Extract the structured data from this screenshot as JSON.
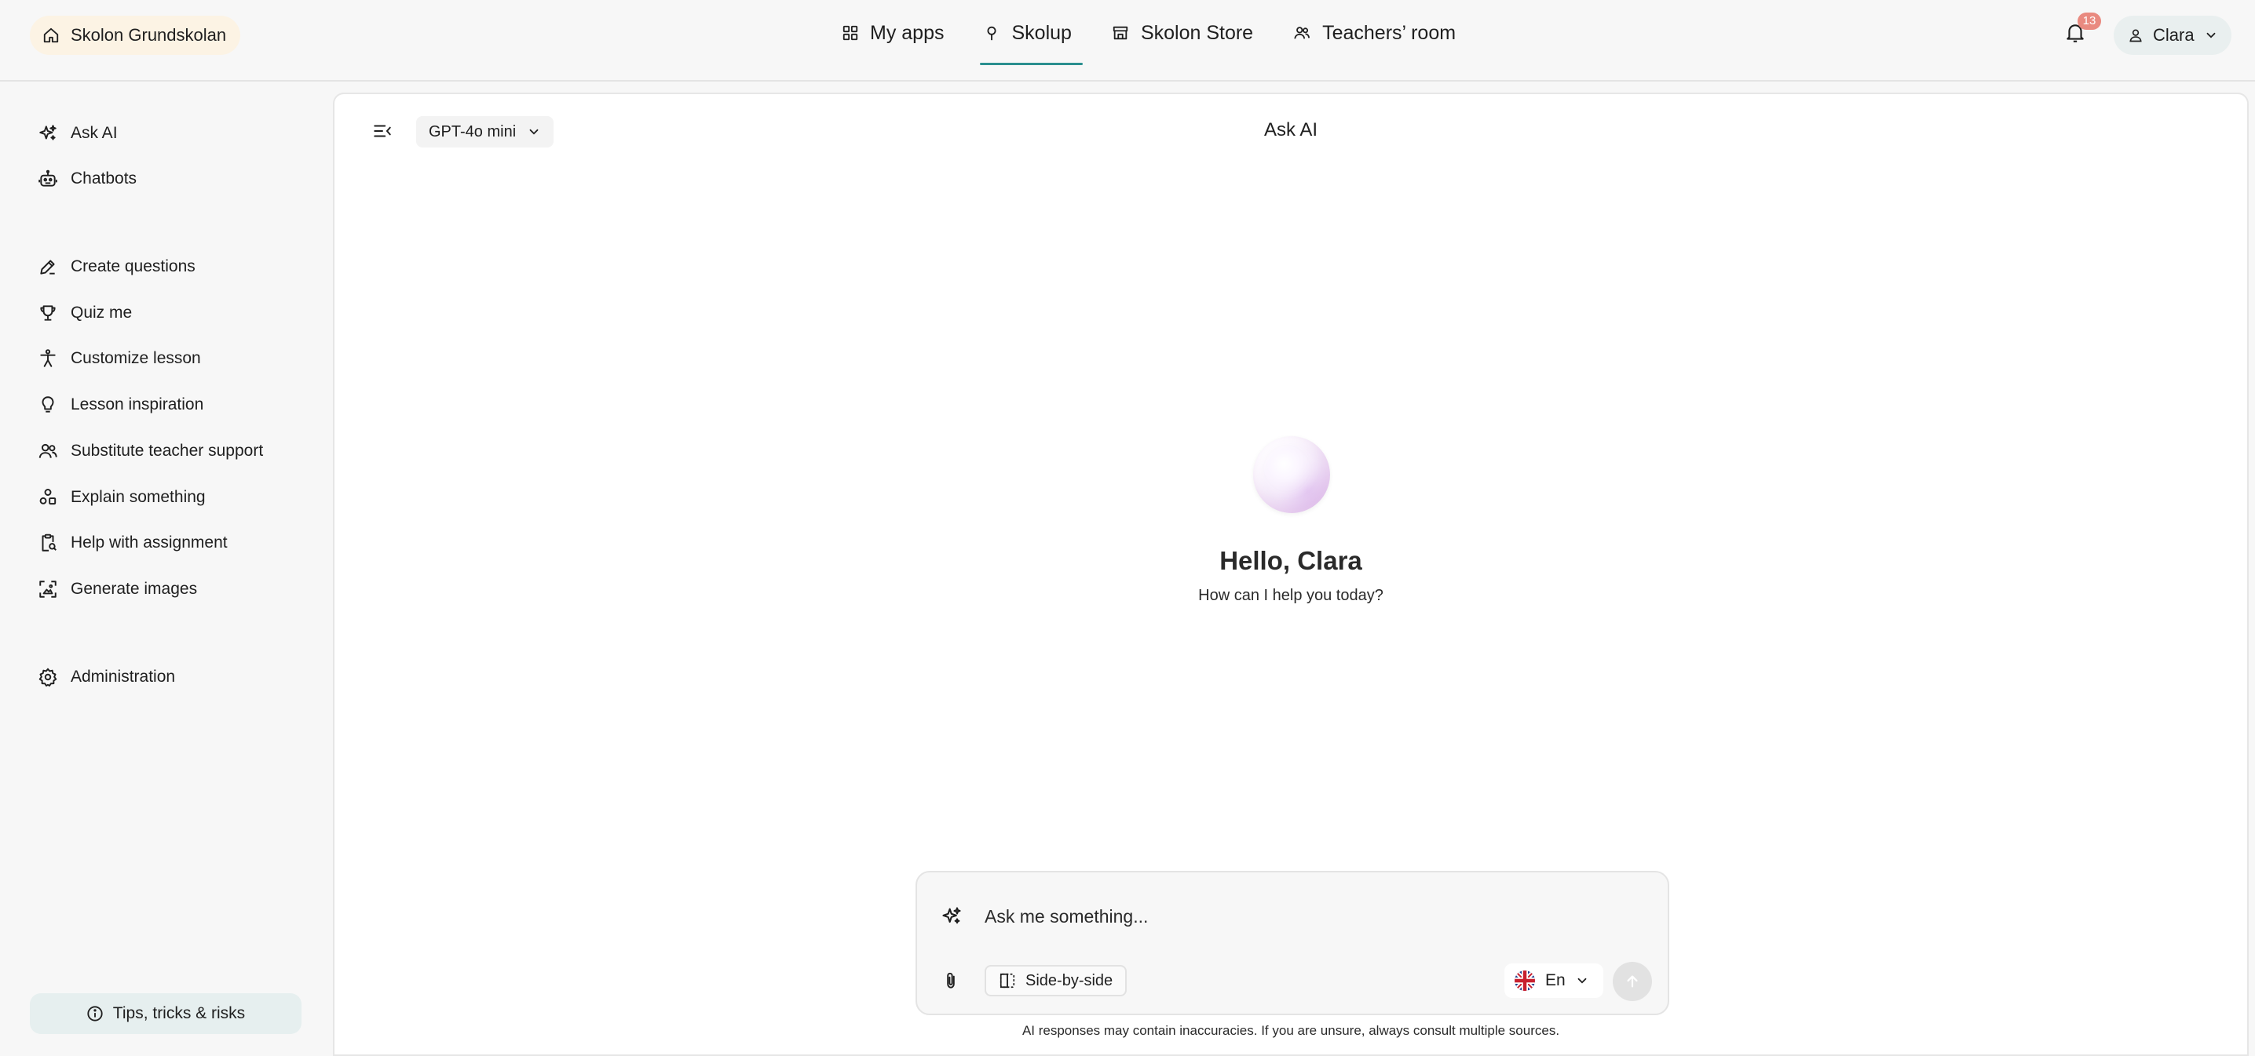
{
  "topbar": {
    "school_name": "Skolon Grundskolan",
    "nav": [
      {
        "label": "My apps",
        "icon": "grid-icon"
      },
      {
        "label": "Skolup",
        "icon": "map-pin-icon",
        "active": true
      },
      {
        "label": "Skolon Store",
        "icon": "store-icon"
      },
      {
        "label": "Teachers’ room",
        "icon": "people-icon"
      }
    ],
    "notification_count": "13",
    "user_name": "Clara"
  },
  "sidebar": {
    "items": [
      {
        "label": "Ask AI",
        "icon": "sparkle-icon"
      },
      {
        "label": "Chatbots",
        "icon": "robot-icon"
      },
      {
        "label": "Create questions",
        "icon": "pen-icon"
      },
      {
        "label": "Quiz me",
        "icon": "trophy-icon"
      },
      {
        "label": "Customize lesson",
        "icon": "accessibility-icon"
      },
      {
        "label": "Lesson inspiration",
        "icon": "lightbulb-icon"
      },
      {
        "label": "Substitute teacher support",
        "icon": "people-icon"
      },
      {
        "label": "Explain something",
        "icon": "shapes-icon"
      },
      {
        "label": "Help with assignment",
        "icon": "clipboard-search-icon"
      },
      {
        "label": "Generate images",
        "icon": "image-frame-icon"
      },
      {
        "label": "Administration",
        "icon": "gear-icon"
      }
    ],
    "tips_label": "Tips, tricks & risks"
  },
  "main": {
    "model": "GPT-4o mini",
    "title": "Ask AI",
    "greeting": "Hello, Clara",
    "subtitle": "How can I help you today?",
    "composer": {
      "placeholder": "Ask me something...",
      "side_by_side_label": "Side-by-side",
      "language": "En"
    },
    "disclaimer": "AI responses may contain inaccuracies. If you are unsure, always consult multiple sources."
  },
  "colors": {
    "accent": "#2a8f8f",
    "badge": "#e98a80",
    "school_chip": "#fcf3e4",
    "user_chip": "#e9efef"
  }
}
